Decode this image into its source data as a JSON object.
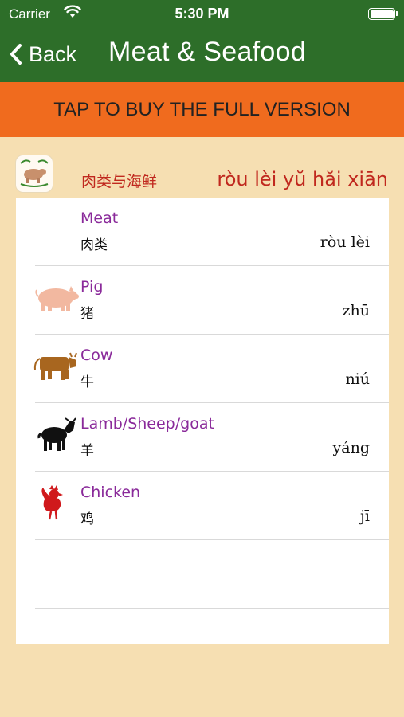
{
  "status_bar": {
    "carrier": "Carrier",
    "time": "5:30 PM"
  },
  "nav": {
    "back_label": "Back",
    "title": "Meat & Seafood"
  },
  "promo": {
    "label": "TAP TO BUY THE FULL VERSION"
  },
  "category": {
    "chinese": "肉类与海鲜",
    "pinyin": "ròu lèi yŭ hăi xiān"
  },
  "items": [
    {
      "english": "Meat",
      "chinese": "肉类",
      "pinyin": "ròu lèi",
      "icon": "none"
    },
    {
      "english": "Pig",
      "chinese": "猪",
      "pinyin": "zhū",
      "icon": "pig-icon"
    },
    {
      "english": "Cow",
      "chinese": "牛",
      "pinyin": "niú",
      "icon": "cow-icon"
    },
    {
      "english": "Lamb/Sheep/goat",
      "chinese": "羊",
      "pinyin": "yáng",
      "icon": "lamb-icon"
    },
    {
      "english": "Chicken",
      "chinese": "鸡",
      "pinyin": "jī",
      "icon": "chicken-icon"
    }
  ],
  "colors": {
    "nav_green": "#2d6e29",
    "promo_orange": "#f06b1e",
    "background": "#f6dfb2",
    "english_purple": "#8a2a9a",
    "category_red": "#c0281e"
  }
}
